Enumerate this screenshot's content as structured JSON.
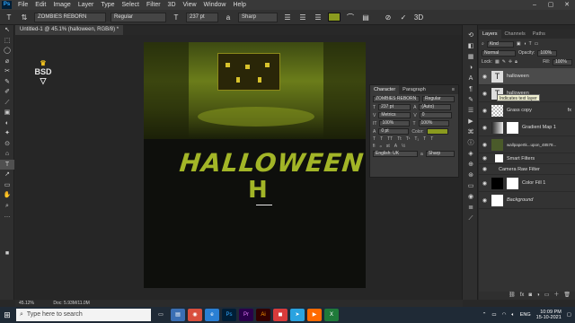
{
  "menubar": {
    "app_icon": "Ps",
    "items": [
      "File",
      "Edit",
      "Image",
      "Layer",
      "Type",
      "Select",
      "Filter",
      "3D",
      "View",
      "Window",
      "Help"
    ],
    "window_controls": [
      "–",
      "▢",
      "✕"
    ]
  },
  "optbar": {
    "tool_icon": "T",
    "font_family": "ZOMBIES REBORN",
    "font_style": "Regular",
    "font_size": "237 pt",
    "antialias": "Sharp",
    "color_swatch": "#8a9a1f"
  },
  "tools": [
    "↖",
    "⬚",
    "◯",
    "⌀",
    "✂",
    "✎",
    "✐",
    "⟋",
    "▣",
    "◐",
    "✦",
    "⊙",
    "⌂",
    "T",
    "↗",
    "▭",
    "✋",
    "⌕",
    "…",
    "■"
  ],
  "document": {
    "tab_title": "Untitled-1 @ 45.1% (halloween, RGB/8) *",
    "title_text": "HALLOWEEN",
    "second_text": "H",
    "logo_text": "BSD",
    "status_zoom": "45.12%",
    "status_doc": "Doc: 5.93M/11.0M"
  },
  "character_panel": {
    "tabs": [
      "Character",
      "Paragraph"
    ],
    "font_family": "ZOMBIES REBORN",
    "font_style": "Regular",
    "size": "237 pt",
    "leading": "(Auto)",
    "kerning": "Metrics",
    "tracking": "0",
    "vscale": "100%",
    "hscale": "100%",
    "baseline": "0 pt",
    "color_label": "Color:",
    "language": "English: UK",
    "antialias": "Sharp"
  },
  "layers_panel": {
    "tabs": [
      "Layers",
      "Channels",
      "Paths"
    ],
    "search_placeholder": "Kind",
    "blend_mode": "Normal",
    "opacity_label": "Opacity:",
    "opacity": "100%",
    "lock_label": "Lock:",
    "fill_label": "Fill:",
    "fill": "100%",
    "tooltip": "Indicates text layer",
    "layers": [
      {
        "name": "halloween",
        "thumb": "T",
        "selected": true
      },
      {
        "name": "halloween",
        "thumb": "T",
        "selected": false
      },
      {
        "name": "Grass copy",
        "thumb": "",
        "selected": false
      },
      {
        "name": "Gradient Map 1",
        "thumb": "",
        "selected": false
      },
      {
        "name": "wallpapertk...upon_48578...",
        "thumb": "",
        "selected": false
      },
      {
        "name": "Smart Filters",
        "thumb": "",
        "selected": false
      },
      {
        "name": "Camera Raw Filter",
        "thumb": "",
        "selected": false
      },
      {
        "name": "Color Fill 1",
        "thumb": "",
        "selected": false
      },
      {
        "name": "Background",
        "thumb": "",
        "selected": false
      }
    ]
  },
  "taskbar": {
    "search_placeholder": "Type here to search",
    "language": "ENG",
    "time": "10:09 PM",
    "date": "15-10-2021"
  }
}
